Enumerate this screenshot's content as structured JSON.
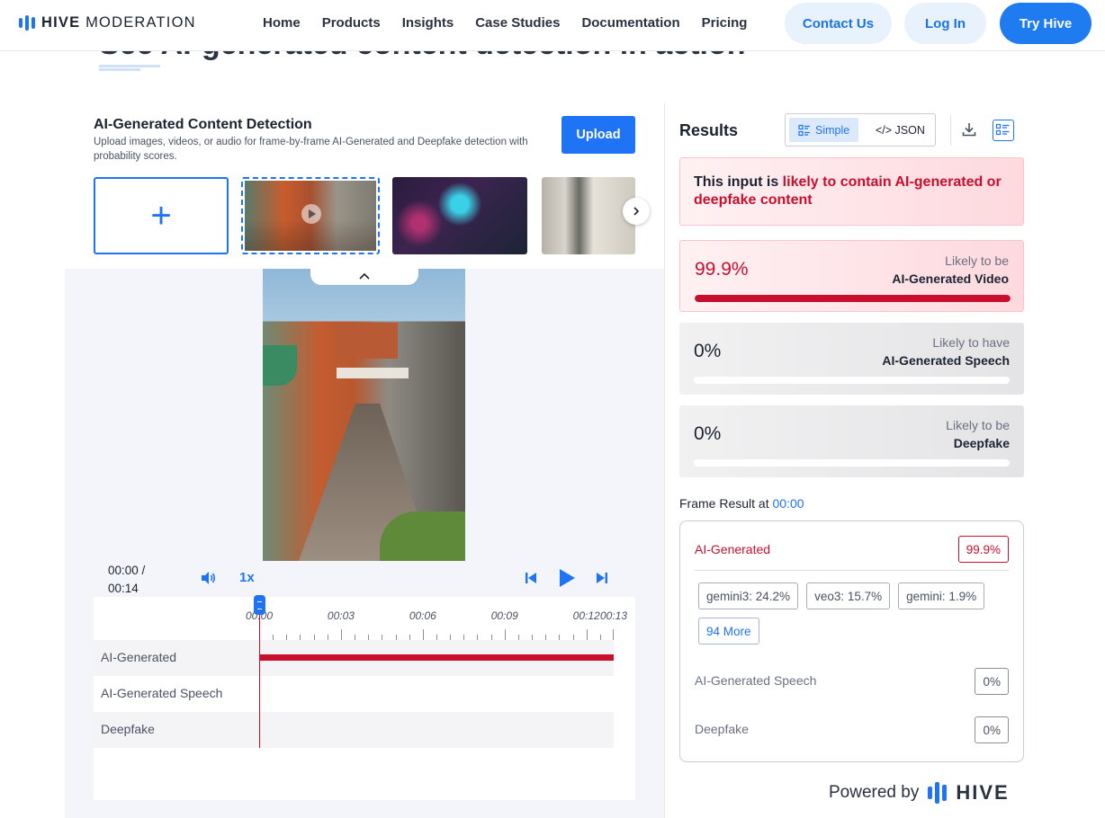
{
  "header": {
    "logo": {
      "brand": "HIVE",
      "product": "MODERATION"
    },
    "nav": [
      "Home",
      "Products",
      "Insights",
      "Case Studies",
      "Documentation",
      "Pricing"
    ],
    "contact_label": "Contact Us",
    "login_label": "Log In",
    "try_label": "Try Hive"
  },
  "page": {
    "ghost_title": "See AI-generated content detection in action"
  },
  "detector": {
    "title": "AI-Generated Content Detection",
    "subtitle": "Upload images, videos, or audio for frame-by-frame AI-Generated and Deepfake detection with probability scores.",
    "upload_label": "Upload",
    "add_icon": "plus-icon",
    "next_icon": "chevron-right-icon",
    "collapse_icon": "chevron-up-icon"
  },
  "player": {
    "time_current": "00:00 /",
    "time_total": "00:14",
    "speed": "1x",
    "ruler_labels": [
      "00:00",
      "00:03",
      "00:06",
      "00:09",
      "00:12",
      "00:13"
    ],
    "tracks": [
      {
        "name": "AI-Generated",
        "fill": 1.0
      },
      {
        "name": "AI-Generated Speech",
        "fill": 0
      },
      {
        "name": "Deepfake",
        "fill": 0
      }
    ]
  },
  "results": {
    "title": "Results",
    "view_simple": "Simple",
    "view_json": "</> JSON",
    "verdict_prefix": "This input is ",
    "verdict_highlight": "likely to contain AI-generated or deepfake content",
    "cards": [
      {
        "pct": "99.9%",
        "value": 0.999,
        "line1": "Likely to be",
        "line2": "AI-Generated Video"
      },
      {
        "pct": "0%",
        "value": 0,
        "line1": "Likely to have",
        "line2": "AI-Generated Speech"
      },
      {
        "pct": "0%",
        "value": 0,
        "line1": "Likely to be",
        "line2": "Deepfake"
      }
    ],
    "frame_label": "Frame Result at ",
    "frame_time": "00:00",
    "frame": {
      "ai_name": "AI-Generated",
      "ai_value": "99.9%",
      "chips": [
        "gemini3: 24.2%",
        "veo3: 15.7%",
        "gemini: 1.9%"
      ],
      "more_label": "94 More",
      "speech_name": "AI-Generated Speech",
      "speech_value": "0%",
      "deepfake_name": "Deepfake",
      "deepfake_value": "0%"
    },
    "powered_by": "Powered by",
    "powered_brand": "HIVE"
  },
  "colors": {
    "accent": "#1e74f5",
    "alert": "#c8102e"
  }
}
